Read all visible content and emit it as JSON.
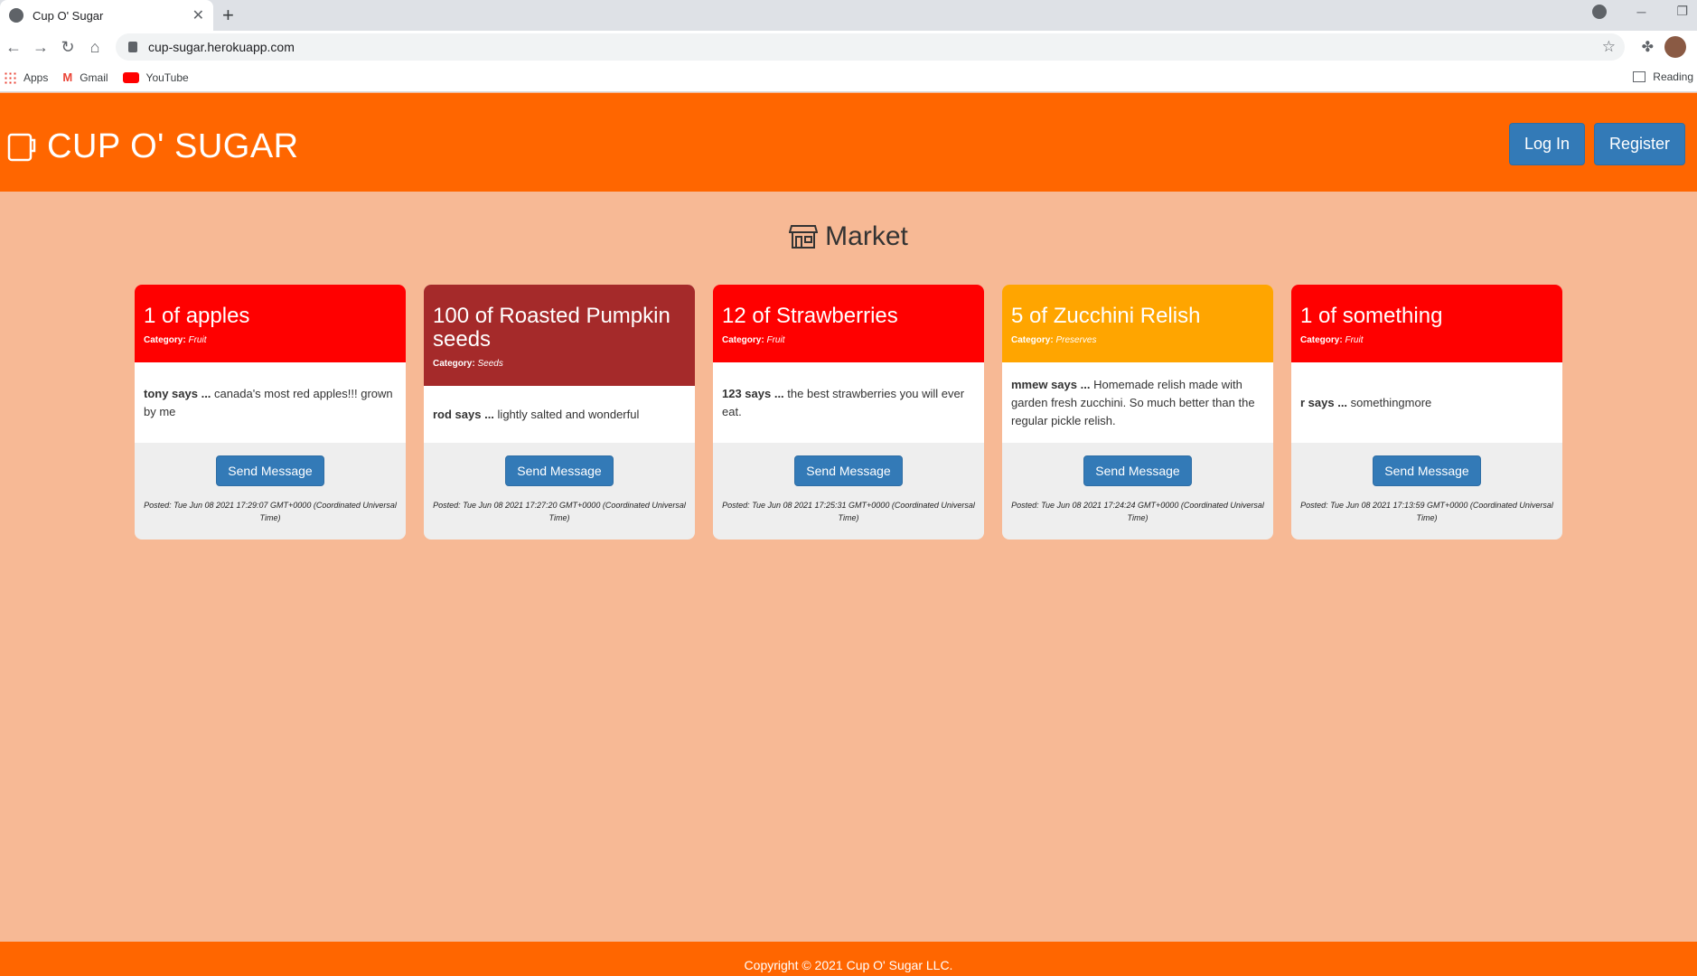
{
  "browser": {
    "tab_title": "Cup O' Sugar",
    "new_tab": "+",
    "url": "cup-sugar.herokuapp.com",
    "bookmarks": [
      "Apps",
      "Gmail",
      "YouTube"
    ],
    "reading_list": "Reading"
  },
  "header": {
    "brand": "CUP O' SUGAR",
    "login_label": "Log In",
    "register_label": "Register"
  },
  "main": {
    "title": "Market",
    "send_label": "Send Message",
    "cards": [
      {
        "title": "1 of apples",
        "category_label": "Category:",
        "category": "Fruit",
        "color": "#ff0000",
        "user": "tony says ...",
        "message": "canada's most red apples!!! grown by me",
        "posted": "Posted: Tue Jun 08 2021 17:29:07 GMT+0000 (Coordinated Universal Time)"
      },
      {
        "title": "100 of Roasted Pumpkin seeds",
        "category_label": "Category:",
        "category": "Seeds",
        "color": "#a52a2a",
        "user": "rod says ...",
        "message": "lightly salted and wonderful",
        "posted": "Posted: Tue Jun 08 2021 17:27:20 GMT+0000 (Coordinated Universal Time)"
      },
      {
        "title": "12 of Strawberries",
        "category_label": "Category:",
        "category": "Fruit",
        "color": "#ff0000",
        "user": "123 says ...",
        "message": "the best strawberries you will ever eat.",
        "posted": "Posted: Tue Jun 08 2021 17:25:31 GMT+0000 (Coordinated Universal Time)"
      },
      {
        "title": "5 of Zucchini Relish",
        "category_label": "Category:",
        "category": "Preserves",
        "color": "#ffa500",
        "user": "mmew says ...",
        "message": "Homemade relish made with garden fresh zucchini. So much better than the regular pickle relish.",
        "posted": "Posted: Tue Jun 08 2021 17:24:24 GMT+0000 (Coordinated Universal Time)"
      },
      {
        "title": "1 of something",
        "category_label": "Category:",
        "category": "Fruit",
        "color": "#ff0000",
        "user": "r says ...",
        "message": "somethingmore",
        "posted": "Posted: Tue Jun 08 2021 17:13:59 GMT+0000 (Coordinated Universal Time)"
      }
    ]
  },
  "footer": {
    "copyright": "Copyright © 2021 Cup O' Sugar LLC."
  }
}
